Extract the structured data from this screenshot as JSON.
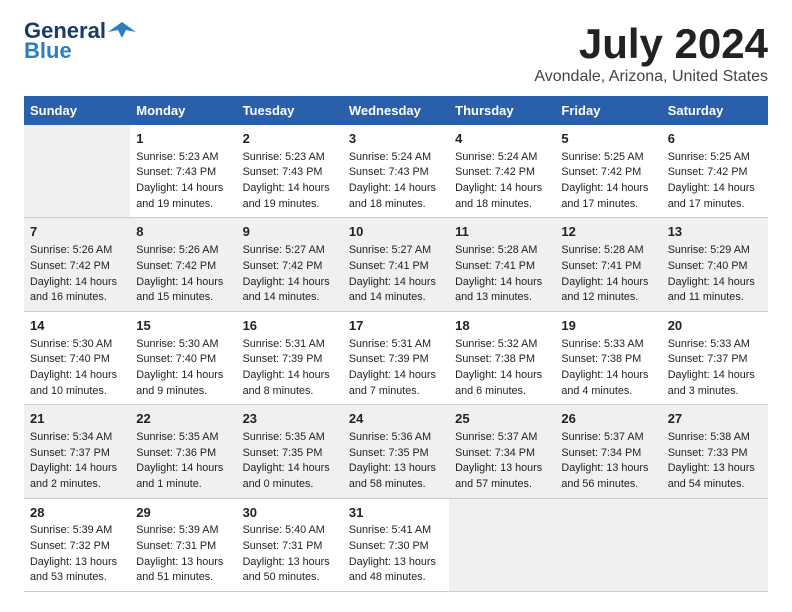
{
  "header": {
    "logo_general": "General",
    "logo_blue": "Blue",
    "month": "July 2024",
    "location": "Avondale, Arizona, United States"
  },
  "weekdays": [
    "Sunday",
    "Monday",
    "Tuesday",
    "Wednesday",
    "Thursday",
    "Friday",
    "Saturday"
  ],
  "weeks": [
    [
      {
        "day": "",
        "sunrise": "",
        "sunset": "",
        "daylight": ""
      },
      {
        "day": "1",
        "sunrise": "Sunrise: 5:23 AM",
        "sunset": "Sunset: 7:43 PM",
        "daylight": "Daylight: 14 hours and 19 minutes."
      },
      {
        "day": "2",
        "sunrise": "Sunrise: 5:23 AM",
        "sunset": "Sunset: 7:43 PM",
        "daylight": "Daylight: 14 hours and 19 minutes."
      },
      {
        "day": "3",
        "sunrise": "Sunrise: 5:24 AM",
        "sunset": "Sunset: 7:43 PM",
        "daylight": "Daylight: 14 hours and 18 minutes."
      },
      {
        "day": "4",
        "sunrise": "Sunrise: 5:24 AM",
        "sunset": "Sunset: 7:42 PM",
        "daylight": "Daylight: 14 hours and 18 minutes."
      },
      {
        "day": "5",
        "sunrise": "Sunrise: 5:25 AM",
        "sunset": "Sunset: 7:42 PM",
        "daylight": "Daylight: 14 hours and 17 minutes."
      },
      {
        "day": "6",
        "sunrise": "Sunrise: 5:25 AM",
        "sunset": "Sunset: 7:42 PM",
        "daylight": "Daylight: 14 hours and 17 minutes."
      }
    ],
    [
      {
        "day": "7",
        "sunrise": "Sunrise: 5:26 AM",
        "sunset": "Sunset: 7:42 PM",
        "daylight": "Daylight: 14 hours and 16 minutes."
      },
      {
        "day": "8",
        "sunrise": "Sunrise: 5:26 AM",
        "sunset": "Sunset: 7:42 PM",
        "daylight": "Daylight: 14 hours and 15 minutes."
      },
      {
        "day": "9",
        "sunrise": "Sunrise: 5:27 AM",
        "sunset": "Sunset: 7:42 PM",
        "daylight": "Daylight: 14 hours and 14 minutes."
      },
      {
        "day": "10",
        "sunrise": "Sunrise: 5:27 AM",
        "sunset": "Sunset: 7:41 PM",
        "daylight": "Daylight: 14 hours and 14 minutes."
      },
      {
        "day": "11",
        "sunrise": "Sunrise: 5:28 AM",
        "sunset": "Sunset: 7:41 PM",
        "daylight": "Daylight: 14 hours and 13 minutes."
      },
      {
        "day": "12",
        "sunrise": "Sunrise: 5:28 AM",
        "sunset": "Sunset: 7:41 PM",
        "daylight": "Daylight: 14 hours and 12 minutes."
      },
      {
        "day": "13",
        "sunrise": "Sunrise: 5:29 AM",
        "sunset": "Sunset: 7:40 PM",
        "daylight": "Daylight: 14 hours and 11 minutes."
      }
    ],
    [
      {
        "day": "14",
        "sunrise": "Sunrise: 5:30 AM",
        "sunset": "Sunset: 7:40 PM",
        "daylight": "Daylight: 14 hours and 10 minutes."
      },
      {
        "day": "15",
        "sunrise": "Sunrise: 5:30 AM",
        "sunset": "Sunset: 7:40 PM",
        "daylight": "Daylight: 14 hours and 9 minutes."
      },
      {
        "day": "16",
        "sunrise": "Sunrise: 5:31 AM",
        "sunset": "Sunset: 7:39 PM",
        "daylight": "Daylight: 14 hours and 8 minutes."
      },
      {
        "day": "17",
        "sunrise": "Sunrise: 5:31 AM",
        "sunset": "Sunset: 7:39 PM",
        "daylight": "Daylight: 14 hours and 7 minutes."
      },
      {
        "day": "18",
        "sunrise": "Sunrise: 5:32 AM",
        "sunset": "Sunset: 7:38 PM",
        "daylight": "Daylight: 14 hours and 6 minutes."
      },
      {
        "day": "19",
        "sunrise": "Sunrise: 5:33 AM",
        "sunset": "Sunset: 7:38 PM",
        "daylight": "Daylight: 14 hours and 4 minutes."
      },
      {
        "day": "20",
        "sunrise": "Sunrise: 5:33 AM",
        "sunset": "Sunset: 7:37 PM",
        "daylight": "Daylight: 14 hours and 3 minutes."
      }
    ],
    [
      {
        "day": "21",
        "sunrise": "Sunrise: 5:34 AM",
        "sunset": "Sunset: 7:37 PM",
        "daylight": "Daylight: 14 hours and 2 minutes."
      },
      {
        "day": "22",
        "sunrise": "Sunrise: 5:35 AM",
        "sunset": "Sunset: 7:36 PM",
        "daylight": "Daylight: 14 hours and 1 minute."
      },
      {
        "day": "23",
        "sunrise": "Sunrise: 5:35 AM",
        "sunset": "Sunset: 7:35 PM",
        "daylight": "Daylight: 14 hours and 0 minutes."
      },
      {
        "day": "24",
        "sunrise": "Sunrise: 5:36 AM",
        "sunset": "Sunset: 7:35 PM",
        "daylight": "Daylight: 13 hours and 58 minutes."
      },
      {
        "day": "25",
        "sunrise": "Sunrise: 5:37 AM",
        "sunset": "Sunset: 7:34 PM",
        "daylight": "Daylight: 13 hours and 57 minutes."
      },
      {
        "day": "26",
        "sunrise": "Sunrise: 5:37 AM",
        "sunset": "Sunset: 7:34 PM",
        "daylight": "Daylight: 13 hours and 56 minutes."
      },
      {
        "day": "27",
        "sunrise": "Sunrise: 5:38 AM",
        "sunset": "Sunset: 7:33 PM",
        "daylight": "Daylight: 13 hours and 54 minutes."
      }
    ],
    [
      {
        "day": "28",
        "sunrise": "Sunrise: 5:39 AM",
        "sunset": "Sunset: 7:32 PM",
        "daylight": "Daylight: 13 hours and 53 minutes."
      },
      {
        "day": "29",
        "sunrise": "Sunrise: 5:39 AM",
        "sunset": "Sunset: 7:31 PM",
        "daylight": "Daylight: 13 hours and 51 minutes."
      },
      {
        "day": "30",
        "sunrise": "Sunrise: 5:40 AM",
        "sunset": "Sunset: 7:31 PM",
        "daylight": "Daylight: 13 hours and 50 minutes."
      },
      {
        "day": "31",
        "sunrise": "Sunrise: 5:41 AM",
        "sunset": "Sunset: 7:30 PM",
        "daylight": "Daylight: 13 hours and 48 minutes."
      },
      {
        "day": "",
        "sunrise": "",
        "sunset": "",
        "daylight": ""
      },
      {
        "day": "",
        "sunrise": "",
        "sunset": "",
        "daylight": ""
      },
      {
        "day": "",
        "sunrise": "",
        "sunset": "",
        "daylight": ""
      }
    ]
  ]
}
